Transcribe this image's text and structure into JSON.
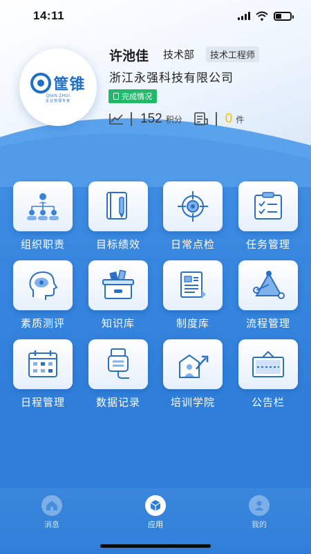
{
  "status": {
    "time": "14:11"
  },
  "profile": {
    "logo_text": "筐锥",
    "logo_sub": "QIAN ZHUI",
    "logo_sub2": "企业管理专家",
    "name": "许池佳",
    "dept": "技术部",
    "role": "技术工程师",
    "company": "浙江永强科技有限公司",
    "done_label": "完成情况",
    "points": "152",
    "points_unit": "积分",
    "items": "0",
    "items_unit": "件"
  },
  "grid": [
    {
      "label": "组织职责",
      "icon": "org-chart-icon"
    },
    {
      "label": "目标绩效",
      "icon": "book-pen-icon"
    },
    {
      "label": "日常点检",
      "icon": "target-icon"
    },
    {
      "label": "任务管理",
      "icon": "clipboard-check-icon"
    },
    {
      "label": "素质测评",
      "icon": "head-brain-icon"
    },
    {
      "label": "知识库",
      "icon": "box-files-icon"
    },
    {
      "label": "制度库",
      "icon": "document-icon"
    },
    {
      "label": "流程管理",
      "icon": "flow-triangle-icon"
    },
    {
      "label": "日程管理",
      "icon": "calendar-icon"
    },
    {
      "label": "数据记录",
      "icon": "usb-data-icon"
    },
    {
      "label": "培训学院",
      "icon": "growth-chart-icon"
    },
    {
      "label": "公告栏",
      "icon": "billboard-icon"
    }
  ],
  "nav": [
    {
      "label": "消息",
      "icon": "home-icon",
      "active": false
    },
    {
      "label": "应用",
      "icon": "cube-icon",
      "active": true
    },
    {
      "label": "我的",
      "icon": "person-icon",
      "active": false
    }
  ],
  "colors": {
    "accent": "#2f7fd9",
    "tag_green": "#21b86a",
    "zero_yellow": "#f5c400"
  }
}
